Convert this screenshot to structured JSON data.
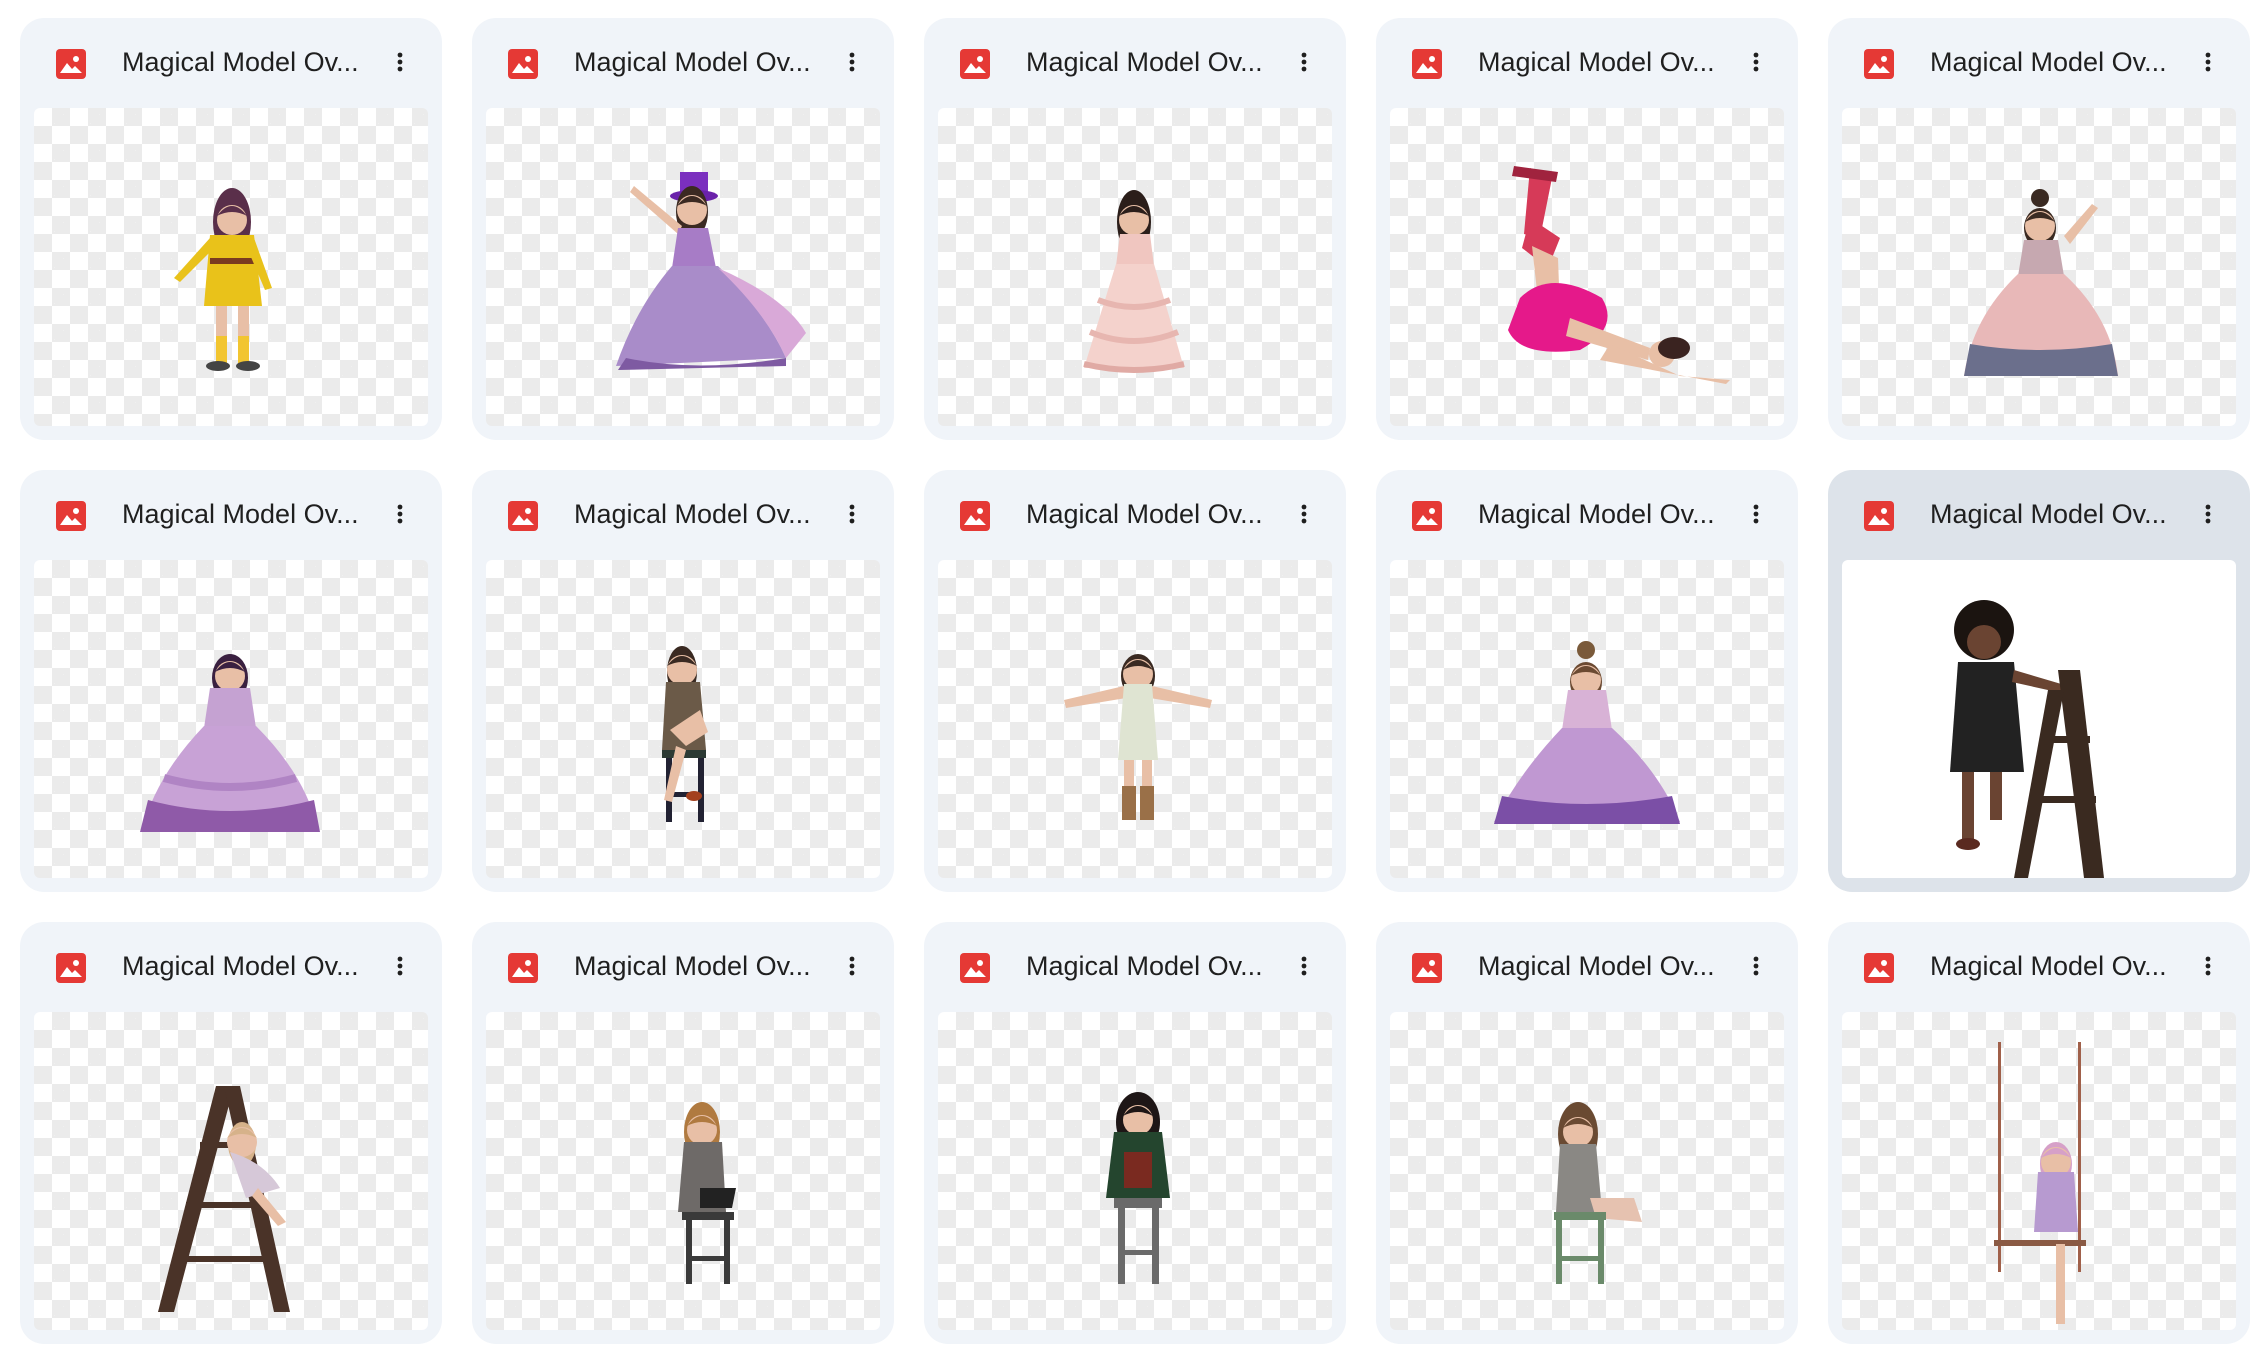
{
  "file_icon": "image-file-icon",
  "more_icon": "more-vertical-icon",
  "colors": {
    "card_bg": "#f0f4f9",
    "card_selected_bg": "#dde3ea",
    "file_icon_red": "#e53935",
    "title_text": "#1f1f1f"
  },
  "files": [
    {
      "name": "Magical Model Ov...",
      "figure": "girl-yellow-dress",
      "selected": false
    },
    {
      "name": "Magical Model Ov...",
      "figure": "girl-purple-gown-hat",
      "selected": false
    },
    {
      "name": "Magical Model Ov...",
      "figure": "girl-pink-ruffle-dress",
      "selected": false
    },
    {
      "name": "Magical Model Ov...",
      "figure": "girl-lying-pink-tutu-boots",
      "selected": false
    },
    {
      "name": "Magical Model Ov...",
      "figure": "girl-pink-ombre-gown",
      "selected": false
    },
    {
      "name": "Magical Model Ov...",
      "figure": "girl-lilac-tulle-gown",
      "selected": false
    },
    {
      "name": "Magical Model Ov...",
      "figure": "girl-sitting-chair-coat",
      "selected": false
    },
    {
      "name": "Magical Model Ov...",
      "figure": "girl-arms-out-white-dress",
      "selected": false
    },
    {
      "name": "Magical Model Ov...",
      "figure": "girl-purple-gown-back",
      "selected": false
    },
    {
      "name": "Magical Model Ov...",
      "figure": "boy-black-shirt-ladder",
      "selected": true
    },
    {
      "name": "Magical Model Ov...",
      "figure": "girl-on-ladder",
      "selected": false
    },
    {
      "name": "Magical Model Ov...",
      "figure": "girl-stool-grey-sweater",
      "selected": false
    },
    {
      "name": "Magical Model Ov...",
      "figure": "girl-stool-green-sweater",
      "selected": false
    },
    {
      "name": "Magical Model Ov...",
      "figure": "girl-green-chair",
      "selected": false
    },
    {
      "name": "Magical Model Ov...",
      "figure": "girl-on-swing",
      "selected": false
    }
  ]
}
